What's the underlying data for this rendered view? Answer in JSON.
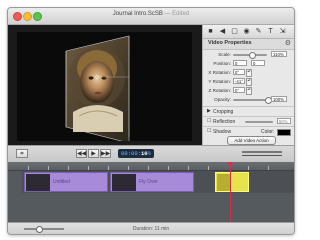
{
  "window": {
    "title": "Journal Intro.ScSB",
    "edited": "— Edited"
  },
  "inspector": {
    "section_title": "Video Properties",
    "rows": {
      "scale": {
        "label": "Scale:",
        "value": "110%",
        "fraction": 0.55
      },
      "position": {
        "label": "Position:",
        "x": "0",
        "y": "0"
      },
      "x_rotation": {
        "label": "X Rotation:",
        "value": "0°"
      },
      "y_rotation": {
        "label": "Y Rotation:",
        "value": "-41°"
      },
      "z_rotation": {
        "label": "Z Rotation:",
        "value": "0°"
      },
      "opacity": {
        "label": "Opacity:",
        "value": "100%",
        "fraction": 1.0
      }
    },
    "sections": {
      "cropping": "Cropping",
      "reflection": "Reflection",
      "reflection_value": "50%",
      "shadow": "Shadow",
      "color": "Color:"
    },
    "add_action_button": "Add Video Action",
    "toolbar_icons": [
      "video-camera-icon",
      "audio-icon",
      "image-icon",
      "globe-icon",
      "pencil-icon",
      "text-icon",
      "export-icon"
    ]
  },
  "transport": {
    "timecode_prefix": "00:00:",
    "timecode_main": "10",
    "timecode_suffix": "½"
  },
  "timeline": {
    "clips": [
      {
        "label": "Untitled"
      },
      {
        "label": "Fly Over"
      },
      {
        "label": ""
      }
    ]
  },
  "status": {
    "duration_text": "Duration: 11 min"
  },
  "colors": {
    "clip_purple": "#a78bd8",
    "clip_selected": "#e6e34d",
    "playhead": "#d2324a",
    "timecode_bg": "#1b2d3e"
  }
}
